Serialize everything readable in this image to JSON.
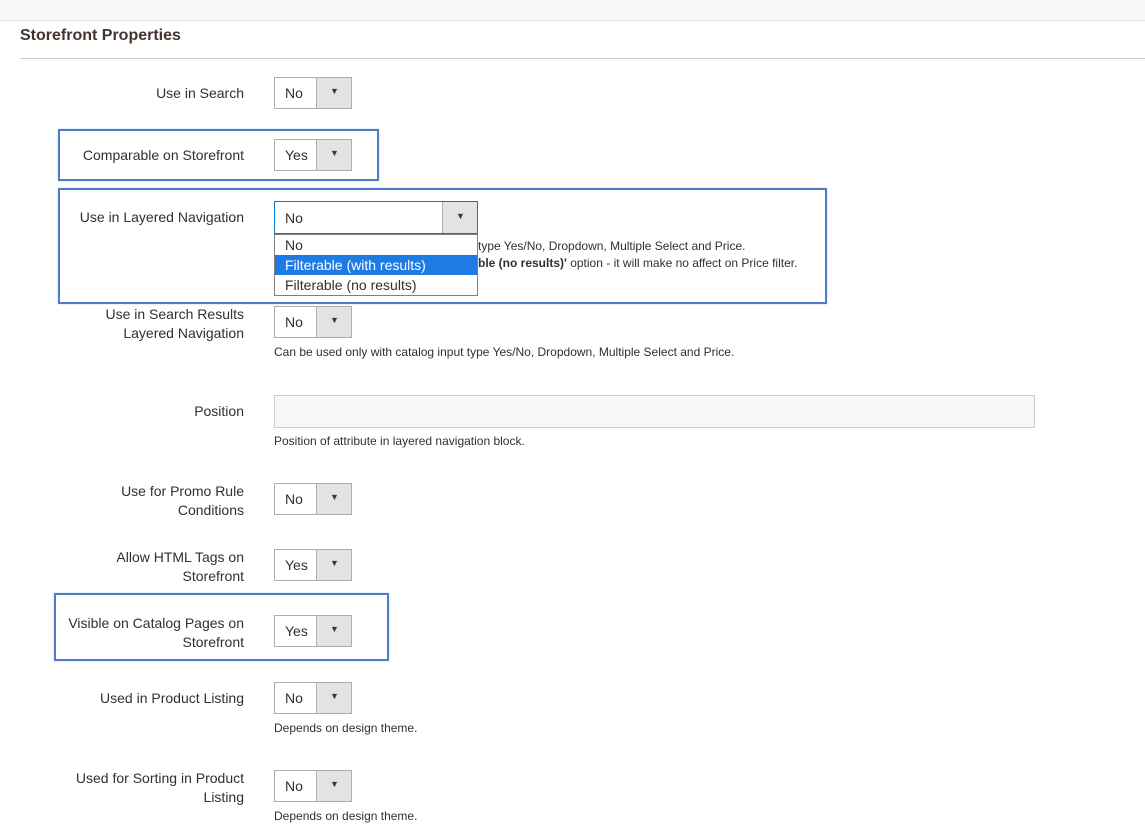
{
  "section": {
    "title": "Storefront Properties"
  },
  "fields": {
    "use_in_search": {
      "label": "Use in Search",
      "value": "No"
    },
    "comparable": {
      "label": "Comparable on Storefront",
      "value": "Yes"
    },
    "layered_nav": {
      "label": "Use in Layered Navigation",
      "value": "No",
      "options": [
        "No",
        "Filterable (with results)",
        "Filterable (no results)"
      ],
      "highlighted_option": "Filterable (with results)",
      "note_line1": "type Yes/No, Dropdown, Multiple Select and Price.",
      "note_line2_bold": "ble (no results)'",
      "note_line2_rest": " option - it will make no affect on Price filter."
    },
    "search_results_layered": {
      "label_line1": "Use in Search Results",
      "label_line2": "Layered Navigation",
      "value": "No",
      "note": "Can be used only with catalog input type Yes/No, Dropdown, Multiple Select and Price."
    },
    "position": {
      "label": "Position",
      "value": "",
      "note": "Position of attribute in layered navigation block."
    },
    "promo_rule": {
      "label_line1": "Use for Promo Rule",
      "label_line2": "Conditions",
      "value": "No"
    },
    "html_tags": {
      "label_line1": "Allow HTML Tags on",
      "label_line2": "Storefront",
      "value": "Yes"
    },
    "visible_catalog": {
      "label_line1": "Visible on Catalog Pages on",
      "label_line2": "Storefront",
      "value": "Yes"
    },
    "product_listing": {
      "label": "Used in Product Listing",
      "value": "No",
      "note": "Depends on design theme."
    },
    "sorting": {
      "label_line1": "Used for Sorting in Product",
      "label_line2": "Listing",
      "value": "No",
      "note": "Depends on design theme."
    }
  },
  "icons": {
    "dropdown_arrow": "▼"
  },
  "colors": {
    "highlight_border": "#4f7cc6",
    "active_option": "#1e7be4",
    "focus_border": "#007bdb"
  }
}
